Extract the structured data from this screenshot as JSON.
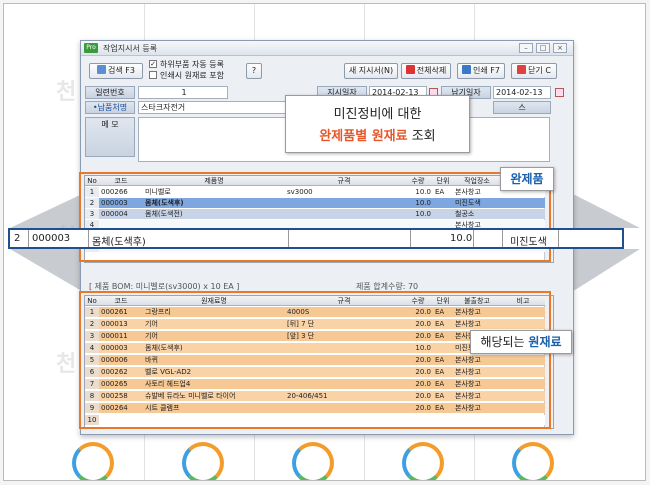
{
  "background": {
    "ghost_text": [
      "천",
      "천",
      "천"
    ]
  },
  "window": {
    "title": "작업지시서 등록",
    "buttons": {
      "search": "검색 F3",
      "help": "?",
      "new_order": "새 지시서(N)",
      "delete_all": "전체삭제",
      "print": "인쇄 F7",
      "close": "닫기 C"
    },
    "checks": {
      "auto_register": "하위부품 자동 등록",
      "include_raw": "인쇄시 원재료 포함",
      "auto_register_checked": "✓"
    },
    "form": {
      "serial_label": "일련번호",
      "serial_value": "1",
      "delivery_label": "•납품처명",
      "delivery_value": "스타크자전거",
      "memo_label": "메   모",
      "order_date_label": "지시일자",
      "order_date_value": "2014-02-13",
      "due_date_label": "납기일자",
      "due_date_value": "2014-02-13",
      "status_suffix": "스"
    }
  },
  "product_grid": {
    "headers": [
      "No",
      "코드",
      "제품명",
      "규격",
      "수량",
      "단위",
      "작업장소"
    ],
    "rows": [
      {
        "no": "1",
        "code": "000266",
        "name": "미니벨로",
        "spec": "sv3000",
        "qty": "10.0",
        "unit": "EA",
        "loc": "본사창고"
      },
      {
        "no": "2",
        "code": "000003",
        "name": "몸체(도색후)",
        "spec": "",
        "qty": "10.0",
        "unit": "",
        "loc": "미진도색"
      },
      {
        "no": "3",
        "code": "000004",
        "name": "몸체(도색전)",
        "spec": "",
        "qty": "10.0",
        "unit": "",
        "loc": "철공소"
      },
      {
        "no": "4",
        "code": "",
        "name": "",
        "spec": "",
        "qty": "",
        "unit": "",
        "loc": "본사창고"
      },
      {
        "no": "5",
        "code": "",
        "name": "",
        "spec": "",
        "qty": "",
        "unit": "",
        "loc": ""
      },
      {
        "no": "6",
        "code": "",
        "name": "",
        "spec": "",
        "qty": "",
        "unit": "",
        "loc": ""
      }
    ]
  },
  "zoom_row": {
    "no": "2",
    "code": "000003",
    "name": "몸체(도색후)",
    "spec": "",
    "qty": "10.0",
    "unit": "",
    "loc": "미진도색"
  },
  "bom_caption": "[ 제품 BOM: 미니벨로(sv3000) x 10 EA ]",
  "bom_total": "제품 합계수량: 70",
  "material_grid": {
    "headers": [
      "No",
      "코드",
      "원재료명",
      "규격",
      "수량",
      "단위",
      "불출창고",
      "비고"
    ],
    "rows": [
      {
        "no": "1",
        "code": "000261",
        "name": "그랑프리",
        "spec": "4000S",
        "qty": "20.0",
        "unit": "EA",
        "wh": "본사창고"
      },
      {
        "no": "2",
        "code": "000013",
        "name": "기어",
        "spec": "[뒤] 7 단",
        "qty": "20.0",
        "unit": "EA",
        "wh": "본사창고"
      },
      {
        "no": "3",
        "code": "000011",
        "name": "기어",
        "spec": "[앞] 3 단",
        "qty": "20.0",
        "unit": "EA",
        "wh": "본사창고"
      },
      {
        "no": "4",
        "code": "000003",
        "name": "몸체(도색후)",
        "spec": "",
        "qty": "10.0",
        "unit": "",
        "wh": "미진도색"
      },
      {
        "no": "5",
        "code": "000006",
        "name": "바퀴",
        "spec": "",
        "qty": "20.0",
        "unit": "EA",
        "wh": "본사창고"
      },
      {
        "no": "6",
        "code": "000262",
        "name": "벨로 VGL-AD2",
        "spec": "",
        "qty": "20.0",
        "unit": "EA",
        "wh": "본사창고"
      },
      {
        "no": "7",
        "code": "000265",
        "name": "사토리 헤드업4",
        "spec": "",
        "qty": "20.0",
        "unit": "EA",
        "wh": "본사창고"
      },
      {
        "no": "8",
        "code": "000258",
        "name": "슈발베 듀라노 미니벨로 타이어",
        "spec": "20-406/451",
        "qty": "20.0",
        "unit": "EA",
        "wh": "본사창고"
      },
      {
        "no": "9",
        "code": "000264",
        "name": "시트 클램프",
        "spec": "",
        "qty": "20.0",
        "unit": "EA",
        "wh": "본사창고"
      },
      {
        "no": "10",
        "code": "",
        "name": "",
        "spec": "",
        "qty": "",
        "unit": "",
        "wh": ""
      }
    ]
  },
  "callouts": {
    "main_line1": "미진정비에 대한",
    "main_line2_a": "완제품별 원재료",
    "main_line2_b": " 조회",
    "finished": "완제품",
    "raw_a": "해당되는 ",
    "raw_b": "원재료"
  },
  "colors": {
    "orange": "#e8792b",
    "selected_row": "#7fa7df",
    "material_fill": "#f6c894",
    "zoom_bar": "#1f4f8f"
  }
}
